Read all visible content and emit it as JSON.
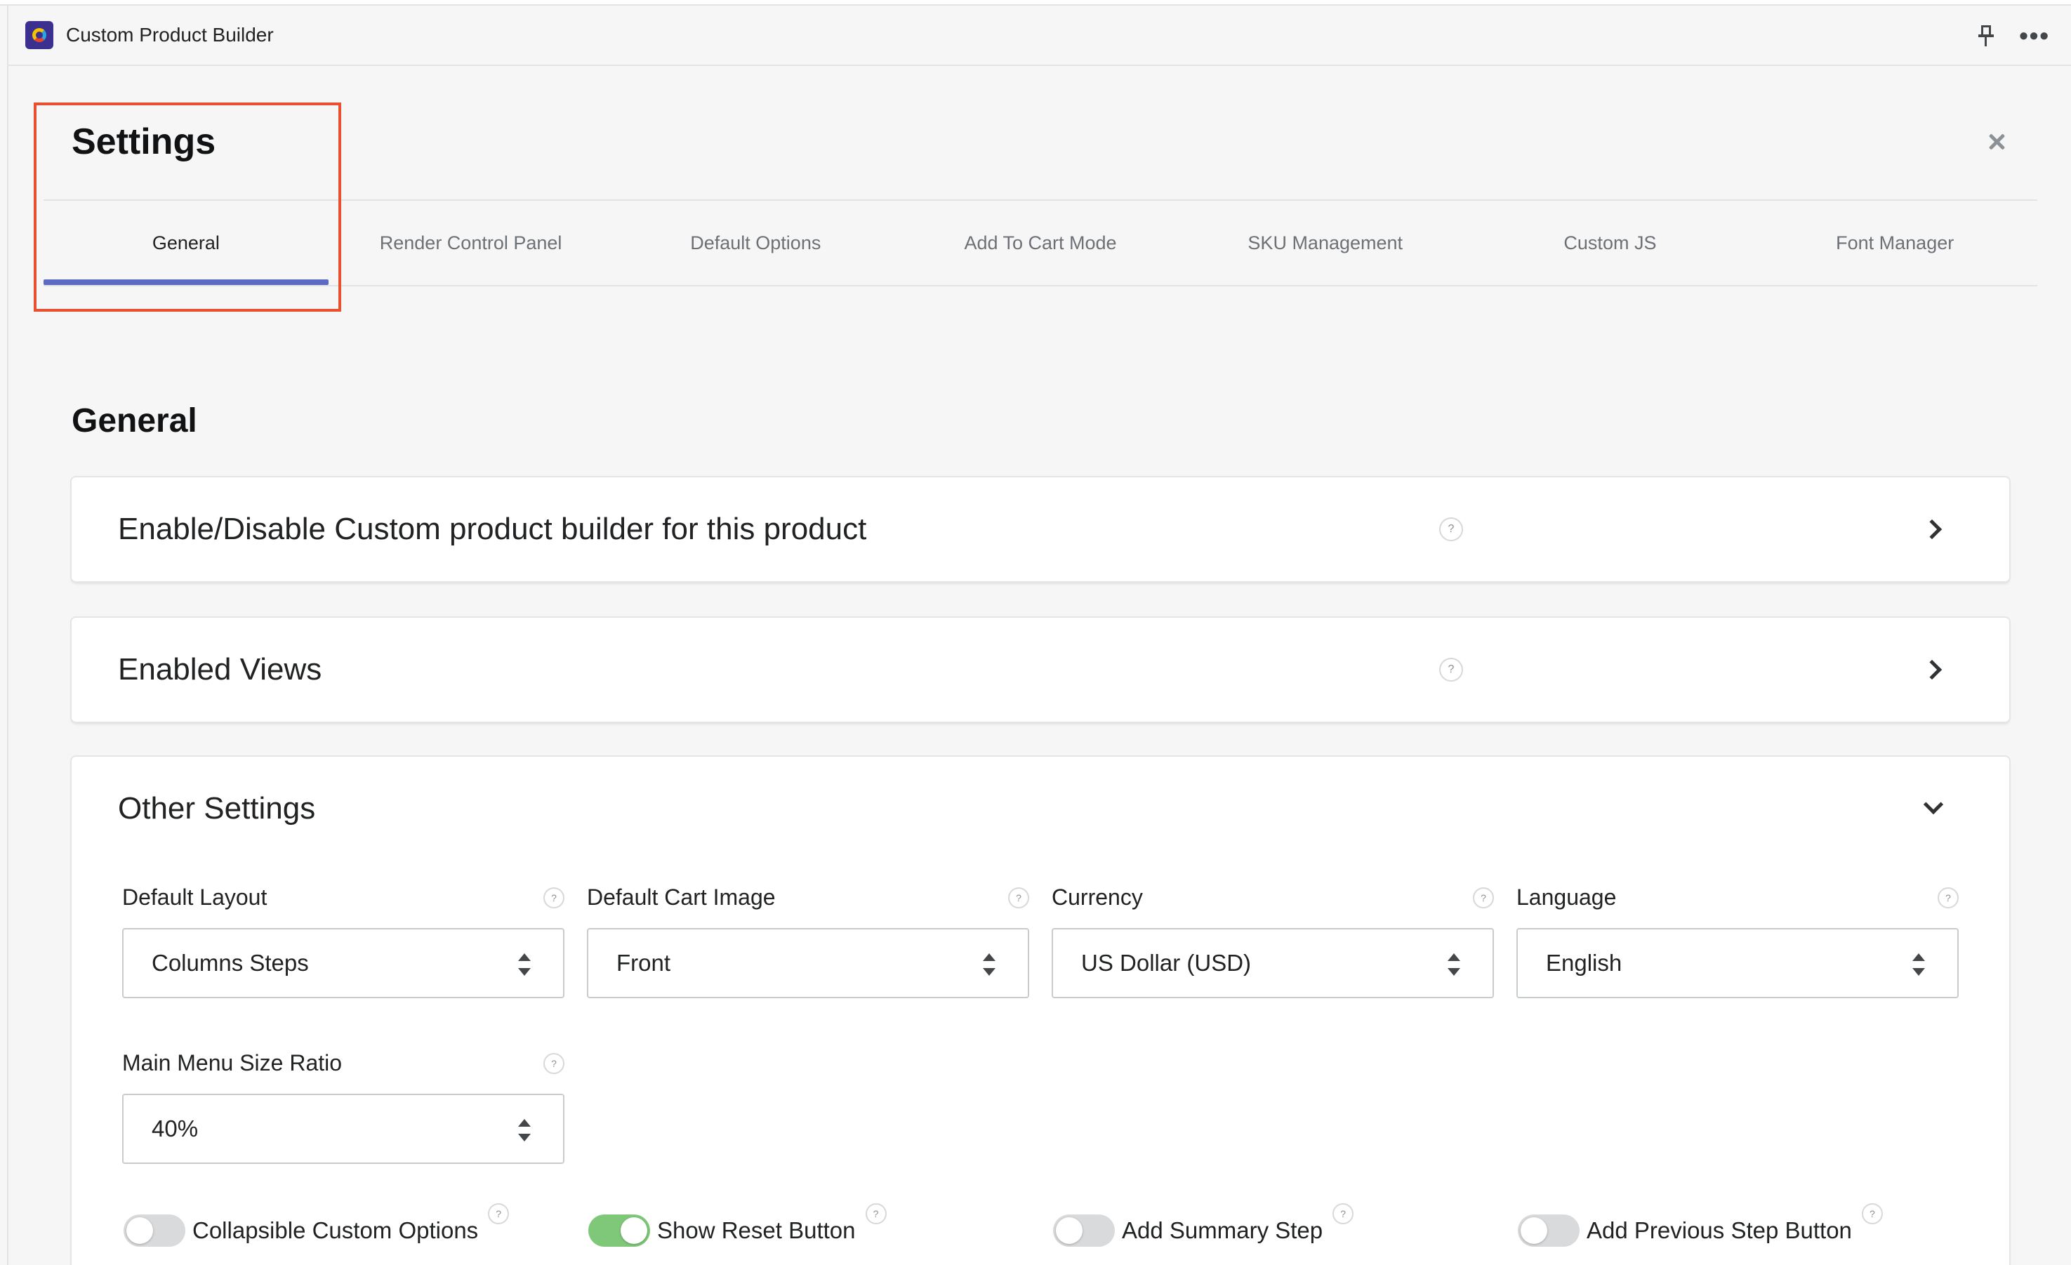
{
  "app": {
    "title": "Custom Product Builder"
  },
  "settings": {
    "title": "Settings",
    "tabs": [
      {
        "label": "General",
        "active": true
      },
      {
        "label": "Render Control Panel",
        "active": false
      },
      {
        "label": "Default Options",
        "active": false
      },
      {
        "label": "Add To Cart Mode",
        "active": false
      },
      {
        "label": "SKU Management",
        "active": false
      },
      {
        "label": "Custom JS",
        "active": false
      },
      {
        "label": "Font Manager",
        "active": false
      }
    ]
  },
  "general": {
    "title": "General",
    "sections": [
      {
        "title": "Enable/Disable Custom product builder for this product",
        "expanded": false
      },
      {
        "title": "Enabled Views",
        "expanded": false
      },
      {
        "title": "Other Settings",
        "expanded": true
      }
    ],
    "help_glyph": "?",
    "fields": [
      {
        "label": "Default Layout",
        "value": "Columns Steps"
      },
      {
        "label": "Default Cart Image",
        "value": "Front"
      },
      {
        "label": "Currency",
        "value": "US Dollar (USD)"
      },
      {
        "label": "Language",
        "value": "English"
      },
      {
        "label": "Main Menu Size Ratio",
        "value": "40%"
      }
    ],
    "toggles": [
      {
        "label": "Collapsible Custom Options",
        "on": false
      },
      {
        "label": "Show Reset Button",
        "on": true
      },
      {
        "label": "Add Summary Step",
        "on": false
      },
      {
        "label": "Add Previous Step Button",
        "on": false
      }
    ]
  },
  "colors": {
    "accent": "#5c6ac4",
    "toggle_on": "#7fc87a",
    "highlight": "#e8502f"
  }
}
